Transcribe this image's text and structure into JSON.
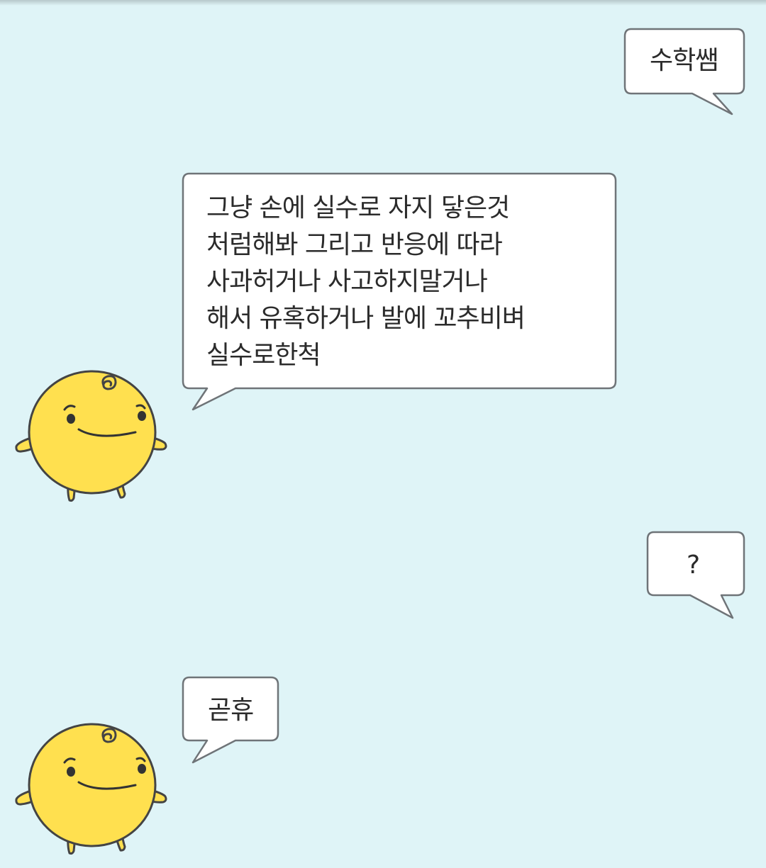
{
  "conversation": {
    "messages": [
      {
        "sender": "user",
        "text": "수학쌤"
      },
      {
        "sender": "bot",
        "text": "그냥 손에 실수로 자지 닿은것\n처럼해봐 그리고 반응에 따라\n사과허거나 사고하지말거나\n해서 유혹하거나 발에 꼬추비벼\n실수로한척"
      },
      {
        "sender": "user",
        "text": "?"
      },
      {
        "sender": "bot",
        "text": "곧휴"
      }
    ]
  },
  "theme": {
    "background": "#dff4f7",
    "bubble_fill": "#ffffff",
    "bubble_border": "#6f7478",
    "avatar_fill": "#ffe04f"
  },
  "avatar": {
    "icon": "simsimi-character-icon"
  }
}
